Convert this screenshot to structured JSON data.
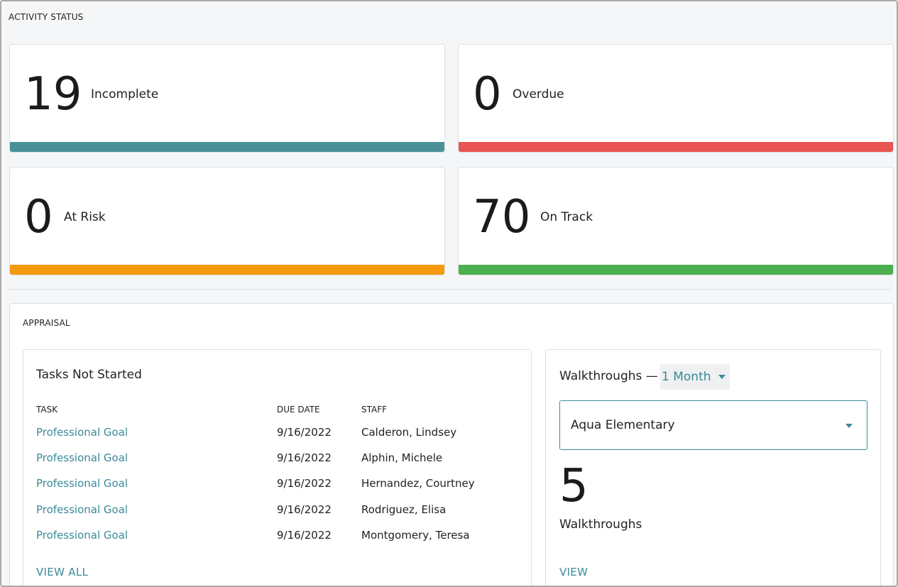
{
  "activity_status": {
    "section_label": "ACTIVITY STATUS",
    "cards": [
      {
        "count": "19",
        "label": "Incomplete",
        "color": "#4a9099"
      },
      {
        "count": "0",
        "label": "Overdue",
        "color": "#e85552"
      },
      {
        "count": "0",
        "label": "At Risk",
        "color": "#f59a0e"
      },
      {
        "count": "70",
        "label": "On Track",
        "color": "#4caf50"
      }
    ]
  },
  "appraisal": {
    "section_label": "APPRAISAL",
    "tasks": {
      "title": "Tasks Not Started",
      "headers": {
        "task": "TASK",
        "due_date": "DUE DATE",
        "staff": "STAFF"
      },
      "rows": [
        {
          "task": "Professional Goal",
          "due_date": "9/16/2022",
          "staff": "Calderon, Lindsey"
        },
        {
          "task": "Professional Goal",
          "due_date": "9/16/2022",
          "staff": "Alphin, Michele"
        },
        {
          "task": "Professional Goal",
          "due_date": "9/16/2022",
          "staff": "Hernandez, Courtney"
        },
        {
          "task": "Professional Goal",
          "due_date": "9/16/2022",
          "staff": "Rodriguez, Elisa"
        },
        {
          "task": "Professional Goal",
          "due_date": "9/16/2022",
          "staff": "Montgomery, Teresa"
        }
      ],
      "view_all_label": "VIEW ALL"
    },
    "walkthroughs": {
      "title": "Walkthroughs —",
      "period_selected": "1 Month",
      "school_selected": "Aqua Elementary",
      "count": "5",
      "count_label": "Walkthroughs",
      "view_label": "VIEW",
      "icons": {
        "period_dropdown": "caret-down-icon",
        "school_dropdown": "caret-down-icon"
      }
    }
  }
}
